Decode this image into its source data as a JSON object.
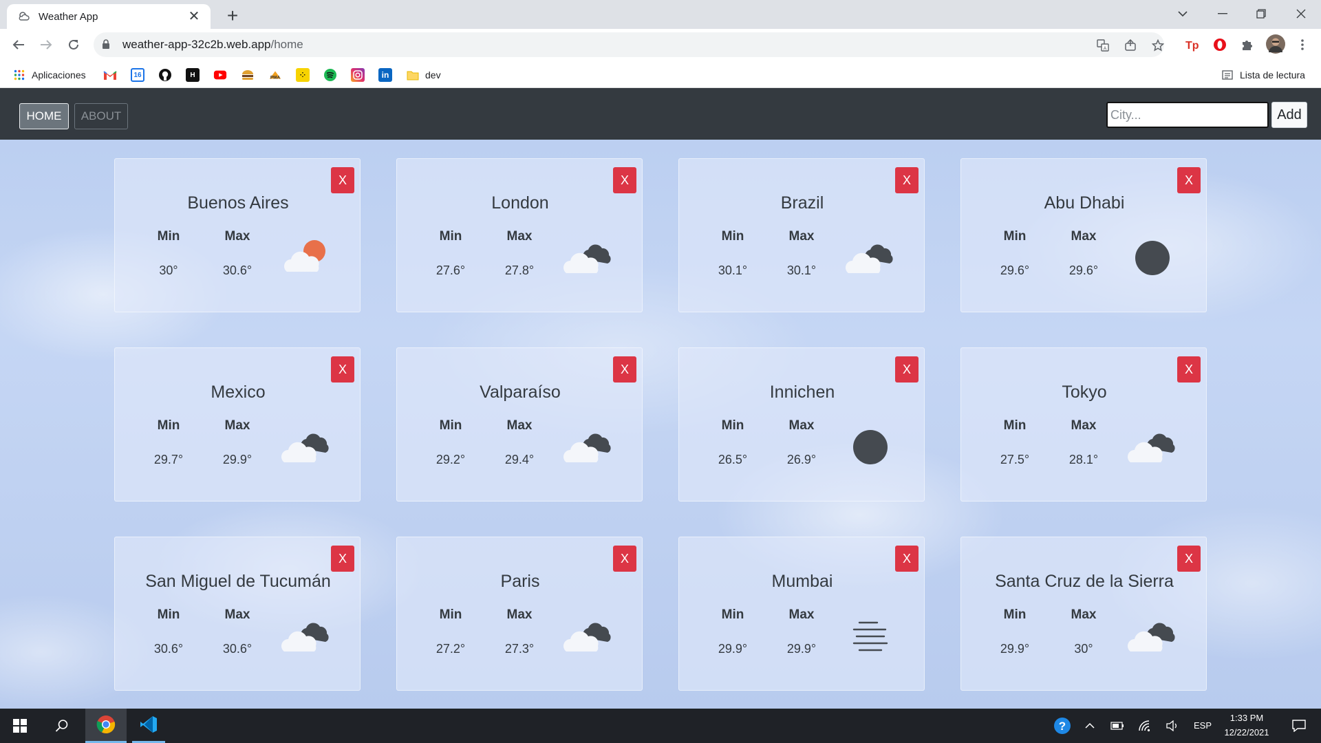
{
  "browser": {
    "tab_title": "Weather App",
    "tab_close": "✕",
    "new_tab": "+",
    "url_host": "weather-app-32c2b.web.app",
    "url_path": "/home",
    "bookmarks": [
      {
        "label": "Aplicaciones",
        "icon": "apps-grid-icon"
      },
      {
        "label": "",
        "icon": "gmail-icon"
      },
      {
        "label": "",
        "icon": "calendar-icon"
      },
      {
        "label": "",
        "icon": "github-icon"
      },
      {
        "label": "",
        "icon": "hdtv-icon"
      },
      {
        "label": "",
        "icon": "youtube-icon"
      },
      {
        "label": "",
        "icon": "burger-icon"
      },
      {
        "label": "",
        "icon": "pma-icon"
      },
      {
        "label": "",
        "icon": "yellow-app-icon"
      },
      {
        "label": "",
        "icon": "spotify-icon"
      },
      {
        "label": "",
        "icon": "instagram-icon"
      },
      {
        "label": "",
        "icon": "linkedin-icon"
      },
      {
        "label": "dev",
        "icon": "folder-icon"
      }
    ],
    "reading_list": "Lista de lectura"
  },
  "navbar": {
    "home_label": "HOME",
    "about_label": "ABOUT",
    "city_placeholder": "City...",
    "add_label": "Add"
  },
  "card_labels": {
    "min": "Min",
    "max": "Max",
    "close": "X"
  },
  "cities": [
    {
      "name": "Buenos Aires",
      "min": "30°",
      "max": "30.6°",
      "icon": "sun-behind-cloud-icon"
    },
    {
      "name": "London",
      "min": "27.6°",
      "max": "27.8°",
      "icon": "broken-clouds-icon"
    },
    {
      "name": "Brazil",
      "min": "30.1°",
      "max": "30.1°",
      "icon": "broken-clouds-icon"
    },
    {
      "name": "Abu Dhabi",
      "min": "29.6°",
      "max": "29.6°",
      "icon": "clear-night-icon"
    },
    {
      "name": "Mexico",
      "min": "29.7°",
      "max": "29.9°",
      "icon": "broken-clouds-icon"
    },
    {
      "name": "Valparaíso",
      "min": "29.2°",
      "max": "29.4°",
      "icon": "broken-clouds-icon"
    },
    {
      "name": "Innichen",
      "min": "26.5°",
      "max": "26.9°",
      "icon": "clear-night-icon"
    },
    {
      "name": "Tokyo",
      "min": "27.5°",
      "max": "28.1°",
      "icon": "broken-clouds-icon"
    },
    {
      "name": "San Miguel de Tucumán",
      "min": "30.6°",
      "max": "30.6°",
      "icon": "broken-clouds-icon"
    },
    {
      "name": "Paris",
      "min": "27.2°",
      "max": "27.3°",
      "icon": "broken-clouds-icon"
    },
    {
      "name": "Mumbai",
      "min": "29.9°",
      "max": "29.9°",
      "icon": "mist-icon"
    },
    {
      "name": "Santa Cruz de la Sierra",
      "min": "29.9°",
      "max": "30°",
      "icon": "broken-clouds-icon"
    }
  ],
  "taskbar": {
    "language": "ESP",
    "time": "1:33 PM",
    "date": "12/22/2021"
  },
  "colors": {
    "navbar": "#343a40",
    "close_button": "#dc3545",
    "sun_orange": "#e8704a",
    "icon_dark": "#454a50"
  }
}
